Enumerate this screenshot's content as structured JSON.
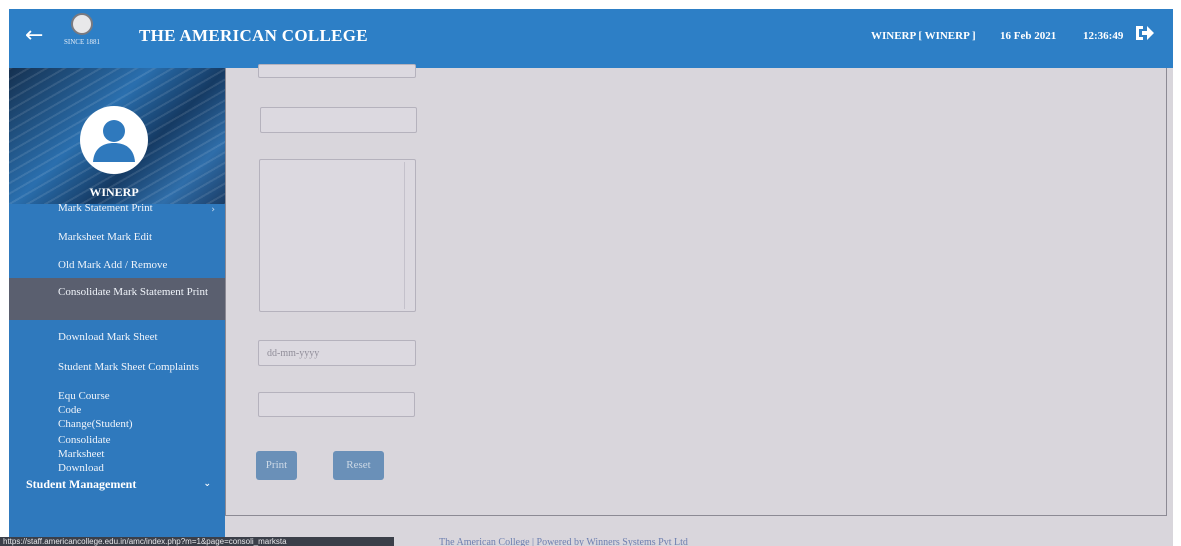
{
  "header": {
    "back_icon": "arrow-left-icon",
    "logo_text": "SINCE 1881",
    "title": "THE AMERICAN COLLEGE",
    "user": "WINERP [ WINERP ]",
    "date": "16 Feb 2021",
    "time": "12:36:49",
    "logout_icon": "logout-arrow-icon",
    "bg_color": "#2d7fc6"
  },
  "sidebar": {
    "profile_name": "WINERP",
    "items": [
      {
        "label": "Mark Statement Print"
      },
      {
        "label": "Marksheet Mark Edit"
      },
      {
        "label": "Old Mark Add / Remove"
      },
      {
        "label": "Consolidate Mark Statement Print"
      },
      {
        "label": "Download Mark Sheet"
      },
      {
        "label": "Student Mark Sheet Complaints"
      },
      {
        "label": "Equ Course Code Change(Student)"
      },
      {
        "label": "Consolidate Marksheet Download"
      }
    ],
    "active_index": 3,
    "section": "Student Management",
    "bg_color": "#2f79bd",
    "active_color": "#5a5f6f"
  },
  "form": {
    "date_placeholder": "dd-mm-yyyy",
    "print_label": "Print",
    "reset_label": "Reset"
  },
  "footer": {
    "text": "The American College | Powered by Winners Systems Pvt Ltd",
    "status_url": "https://staff.americancollege.edu.in/amc/index.php?m=1&page=consoli_marksta"
  }
}
